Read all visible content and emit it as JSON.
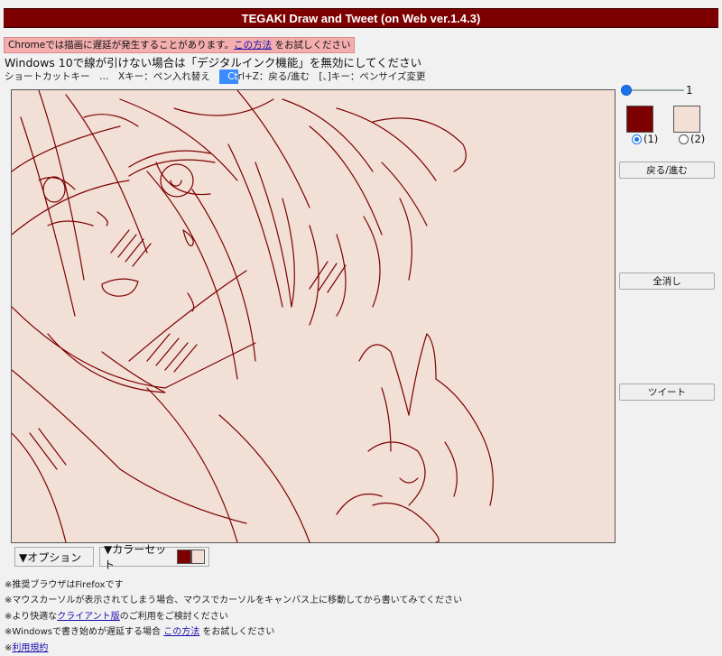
{
  "app": {
    "title": "TEGAKI Draw and Tweet (on Web ver.1.4.3)"
  },
  "notice": {
    "prefix": "Chromeでは描画に遅延が発生することがあります。",
    "link": "この方法",
    "suffix": " をお試しください"
  },
  "win10": {
    "text": "Windows 10で線が引けない場合は「デジタルインク機能」を無効にしてください"
  },
  "shortcuts": {
    "label": "ショートカットキー　…　Xキー：ペン入れ替え　",
    "highlight": "Ct",
    "rest": "rl+Z：戻る/進む　[、]キー：ペンサイズ変更"
  },
  "pen": {
    "size_value": "1",
    "size_fraction": 0.0
  },
  "colors": {
    "pen1": "#7c0000",
    "pen2": "#f2e0d6",
    "canvas_bg": "#f2e0d6",
    "accent": "#7c0000"
  },
  "pens": [
    {
      "label": "(1)",
      "selected": true
    },
    {
      "label": "(2)",
      "selected": false
    }
  ],
  "buttons": {
    "undo": "戻る/進む",
    "clear": "全消し",
    "tweet": "ツイート"
  },
  "options": {
    "option": "▼オプション",
    "colorset": "▼カラーセット"
  },
  "footer": {
    "line1": "※推奨ブラウザはFirefoxです",
    "line2": "※マウスカーソルが表示されてしまう場合、マウスでカーソルをキャンバス上に移動してから書いてみてください",
    "line3_pre": "※より快適な",
    "line3_link": "クライアント版",
    "line3_post": "のご利用をご検討ください",
    "line4_pre": "※Windowsで書き始めが遅延する場合 ",
    "line4_link": "この方法",
    "line4_post": " をお試しください",
    "line5_pre": "※",
    "line5_link": "利用規約"
  }
}
